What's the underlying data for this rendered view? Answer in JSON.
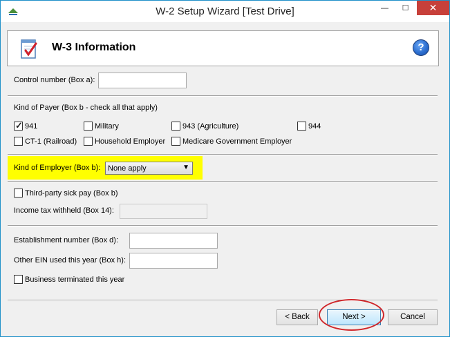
{
  "window": {
    "title": "W-2 Setup Wizard [Test Drive]",
    "controls": {
      "minimize": "—",
      "maximize": "☐",
      "close": "✕"
    }
  },
  "header": {
    "title": "W-3 Information",
    "help": "?"
  },
  "control_number": {
    "label": "Control number (Box a):",
    "value": ""
  },
  "payer": {
    "heading": "Kind of Payer (Box b - check all that apply)",
    "options": [
      {
        "label": "941",
        "checked": true
      },
      {
        "label": "Military",
        "checked": false
      },
      {
        "label": "943 (Agriculture)",
        "checked": false
      },
      {
        "label": "944",
        "checked": false
      },
      {
        "label": "CT-1 (Railroad)",
        "checked": false
      },
      {
        "label": "Household Employer",
        "checked": false
      },
      {
        "label": "Medicare Government Employer",
        "checked": false
      }
    ]
  },
  "employer": {
    "label": "Kind of Employer (Box b):",
    "selected": "None apply"
  },
  "third_party": {
    "label": "Third-party sick pay (Box b)",
    "checked": false
  },
  "income_tax": {
    "label": "Income tax withheld (Box 14):",
    "value": ""
  },
  "establishment": {
    "label": "Establishment number (Box d):",
    "value": ""
  },
  "other_ein": {
    "label": "Other EIN used this year (Box h):",
    "value": ""
  },
  "terminated": {
    "label": "Business terminated this year",
    "checked": false
  },
  "buttons": {
    "back": "< Back",
    "next": "Next >",
    "cancel": "Cancel"
  },
  "colors": {
    "highlight": "#ffff00",
    "annotation": "#d0262a",
    "close_button": "#c7403a"
  }
}
